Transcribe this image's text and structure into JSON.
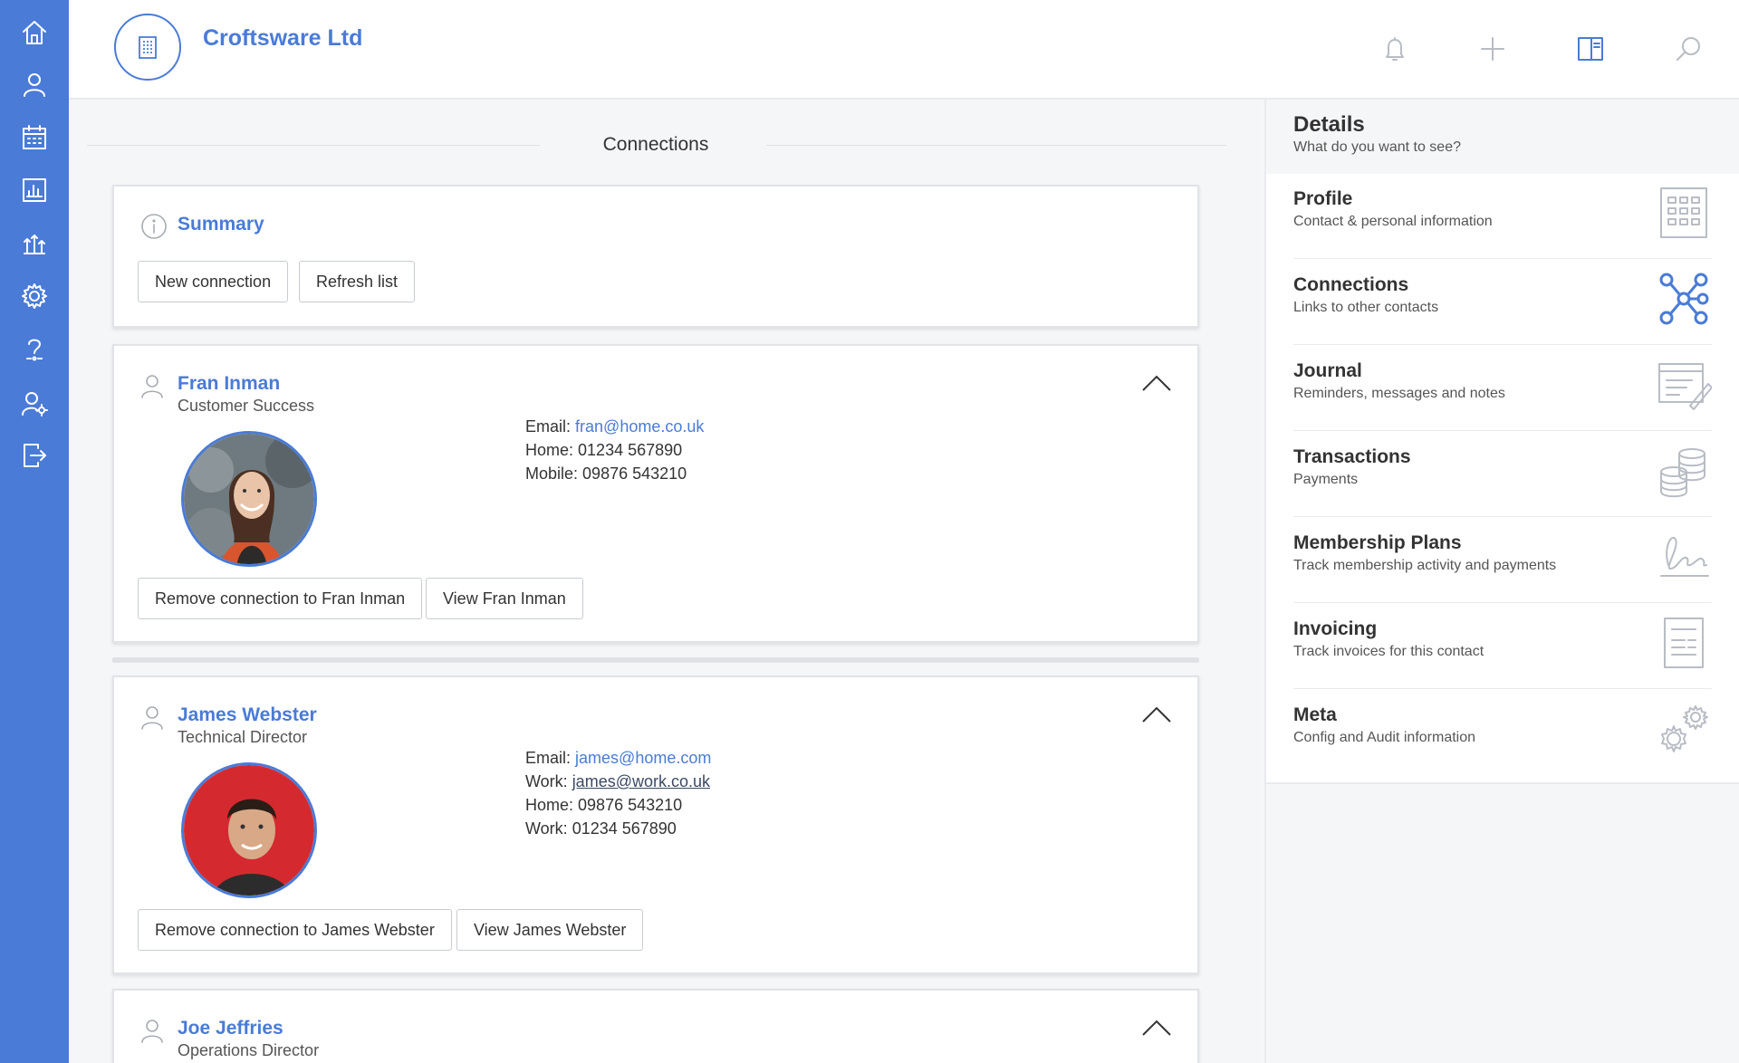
{
  "nav": {
    "items": [
      {
        "icon": "home-icon"
      },
      {
        "icon": "user-icon"
      },
      {
        "icon": "calendar-icon"
      },
      {
        "icon": "chart-icon"
      },
      {
        "icon": "growth-icon"
      },
      {
        "icon": "gear-icon"
      },
      {
        "icon": "help-icon"
      },
      {
        "icon": "user-settings-icon"
      },
      {
        "icon": "logout-icon"
      }
    ]
  },
  "header": {
    "org_name": "Croftsware Ltd",
    "actions": [
      "bell-icon",
      "plus-icon",
      "panel-icon",
      "search-icon"
    ]
  },
  "main": {
    "section_title": "Connections",
    "summary": {
      "title": "Summary",
      "new_connection_label": "New connection",
      "refresh_label": "Refresh list"
    },
    "connections": [
      {
        "name": "Fran Inman",
        "role": "Customer Success",
        "email_label": "Email:",
        "email": "fran@home.co.uk",
        "home_label": "Home:",
        "home": "01234 567890",
        "mobile_label": "Mobile:",
        "mobile": "09876 543210",
        "remove_label": "Remove connection to Fran Inman",
        "view_label": "View Fran Inman"
      },
      {
        "name": "James Webster",
        "role": "Technical Director",
        "email_label": "Email:",
        "email": "james@home.com",
        "work_email_label": "Work:",
        "work_email": "james@work.co.uk",
        "home_label": "Home:",
        "home": "09876 543210",
        "work_label": "Work:",
        "work": "01234 567890",
        "remove_label": "Remove connection to James Webster",
        "view_label": "View James Webster"
      },
      {
        "name": "Joe Jeffries",
        "role": "Operations Director"
      }
    ]
  },
  "details": {
    "title": "Details",
    "subtitle": "What do you want to see?",
    "items": [
      {
        "name": "Profile",
        "desc": "Contact & personal information",
        "icon": "building-icon"
      },
      {
        "name": "Connections",
        "desc": "Links to other contacts",
        "icon": "network-icon",
        "active": true
      },
      {
        "name": "Journal",
        "desc": "Reminders, messages and notes",
        "icon": "journal-icon"
      },
      {
        "name": "Transactions",
        "desc": "Payments",
        "icon": "coins-icon"
      },
      {
        "name": "Membership Plans",
        "desc": "Track membership activity and payments",
        "icon": "signature-icon"
      },
      {
        "name": "Invoicing",
        "desc": "Track invoices for this contact",
        "icon": "invoice-icon"
      },
      {
        "name": "Meta",
        "desc": "Config and Audit information",
        "icon": "gears-icon"
      }
    ]
  },
  "colors": {
    "accent": "#4a7bd6",
    "rail": "#4a7bd6",
    "background": "#f5f6f8"
  }
}
